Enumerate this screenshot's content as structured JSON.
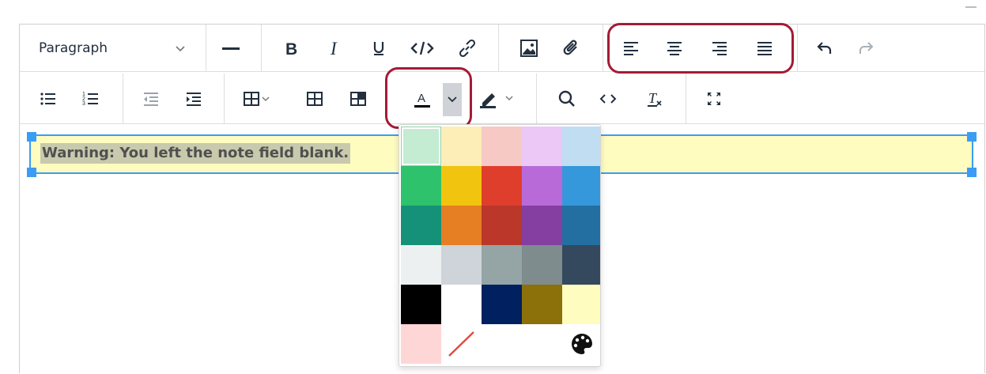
{
  "toolbar": {
    "block_format": "Paragraph",
    "icons": {
      "hr": "horizontal-line-icon",
      "bold": "bold-icon",
      "italic": "italic-icon",
      "underline": "underline-icon",
      "code": "code-icon",
      "link": "link-icon",
      "image": "image-icon",
      "attach": "paperclip-icon",
      "align_left": "align-left-icon",
      "align_center": "align-center-icon",
      "align_right": "align-right-icon",
      "align_justify": "align-justify-icon",
      "undo": "undo-icon",
      "redo": "redo-icon"
    },
    "row2_icons": [
      "bullet-list-icon",
      "numbered-list-icon",
      "outdent-icon",
      "indent-icon",
      "table-icon",
      "table-props-icon",
      "table-cell-icon",
      "text-color-icon",
      "highlight-icon",
      "search-icon",
      "source-code-icon",
      "clear-format-icon",
      "fullscreen-icon"
    ]
  },
  "content": {
    "paragraph": "Warning: You left the note field blank."
  },
  "palette": {
    "rows": [
      [
        "#c3ecd2",
        "#fdeeb8",
        "#f6c9c4",
        "#ebc8f5",
        "#c1ddf2"
      ],
      [
        "#2dc26b",
        "#f1c40f",
        "#e03e2d",
        "#b96ad9",
        "#3598db"
      ],
      [
        "#169179",
        "#e67e23",
        "#ba372a",
        "#843fa1",
        "#236fa1"
      ],
      [
        "#ecf0f1",
        "#ced4d9",
        "#95a5a6",
        "#7e8c8d",
        "#34495e"
      ],
      [
        "#000000",
        "#ffffff",
        "#012060",
        "#8c700a",
        "#fffcbf"
      ]
    ],
    "last_row": [
      "#ffd6d6"
    ],
    "remove_icon": "remove-color-icon",
    "custom_icon": "palette-icon"
  },
  "colors": {
    "highlight_ring": "#a31b34",
    "selection_blue": "#3b9cf6",
    "toolbar_icon": "#222f3e"
  }
}
